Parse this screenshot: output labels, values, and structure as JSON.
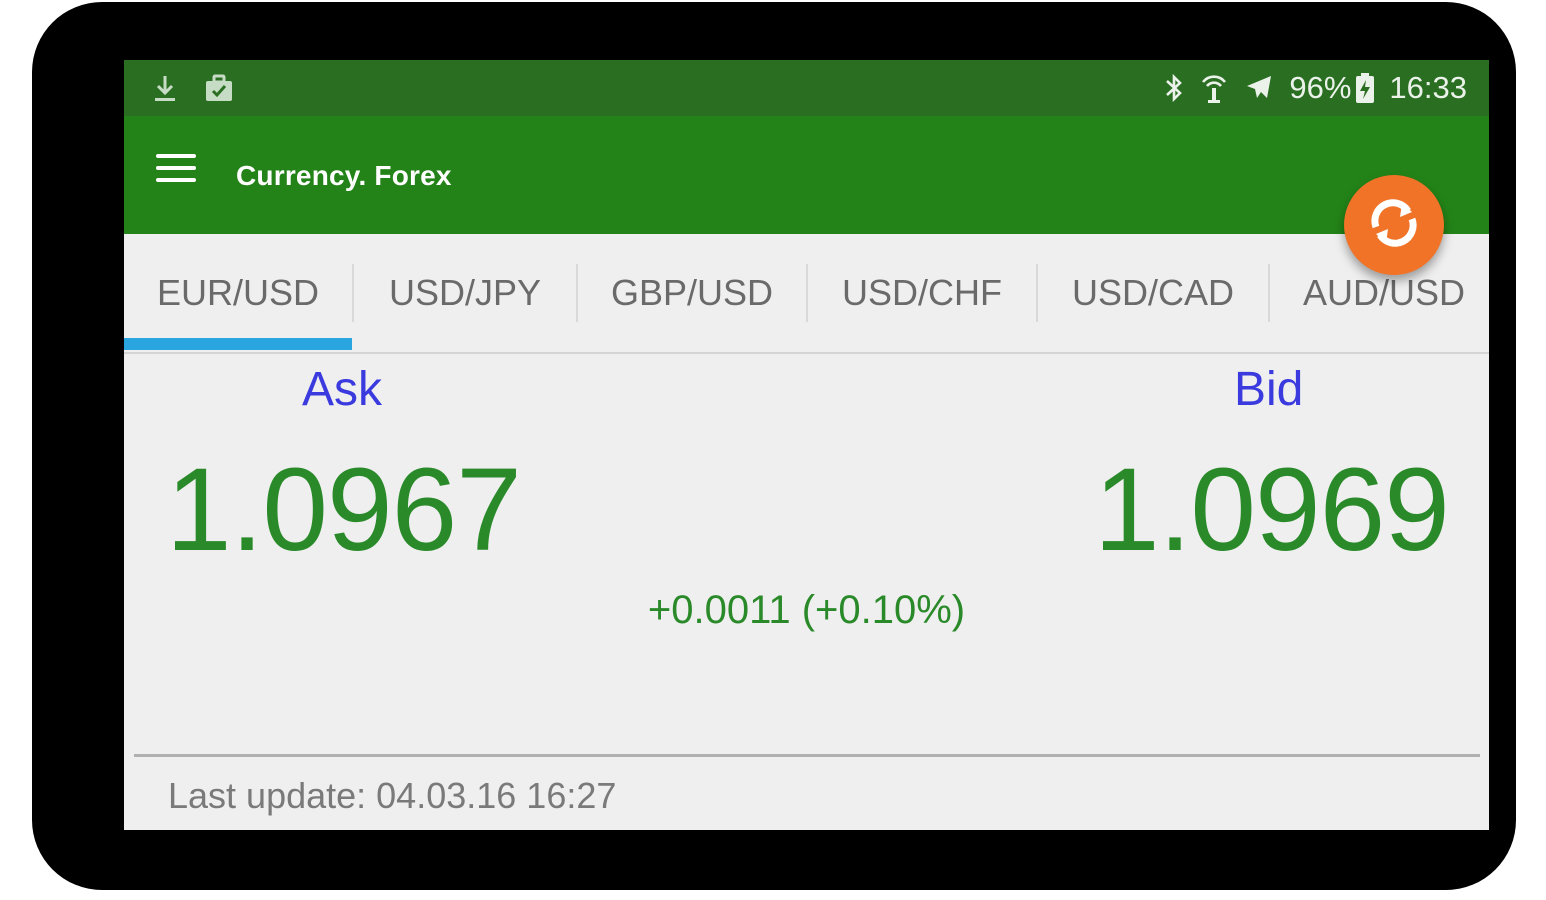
{
  "status_bar": {
    "left_icons": [
      "download-icon",
      "briefcase-icon"
    ],
    "right_icons": [
      "bluetooth-icon",
      "hotspot-icon",
      "airplane-mode-icon",
      "battery-charging-icon"
    ],
    "battery": "96%",
    "time": "16:33"
  },
  "app_bar": {
    "menu_icon": "hamburger-menu-icon",
    "title": "Currency. Forex",
    "refresh_icon": "refresh-icon",
    "refresh_color": "#f07327"
  },
  "tabs": [
    {
      "label": "EUR/USD",
      "selected": true
    },
    {
      "label": "USD/JPY",
      "selected": false
    },
    {
      "label": "GBP/USD",
      "selected": false
    },
    {
      "label": "USD/CHF",
      "selected": false
    },
    {
      "label": "USD/CAD",
      "selected": false
    },
    {
      "label": "AUD/USD",
      "selected": false
    }
  ],
  "quote": {
    "ask_label": "Ask",
    "ask_value": "1.0967",
    "bid_label": "Bid",
    "bid_value": "1.0969",
    "change": "+0.0011 (+0.10%)"
  },
  "footer": {
    "last_update": "Last update: 04.03.16 16:27"
  },
  "colors": {
    "status_bar": "#2a6e22",
    "app_bar": "#238318",
    "tab_indicator": "#29a6e0",
    "label_blue": "#3a3adf",
    "value_green": "#2a8a2a"
  }
}
